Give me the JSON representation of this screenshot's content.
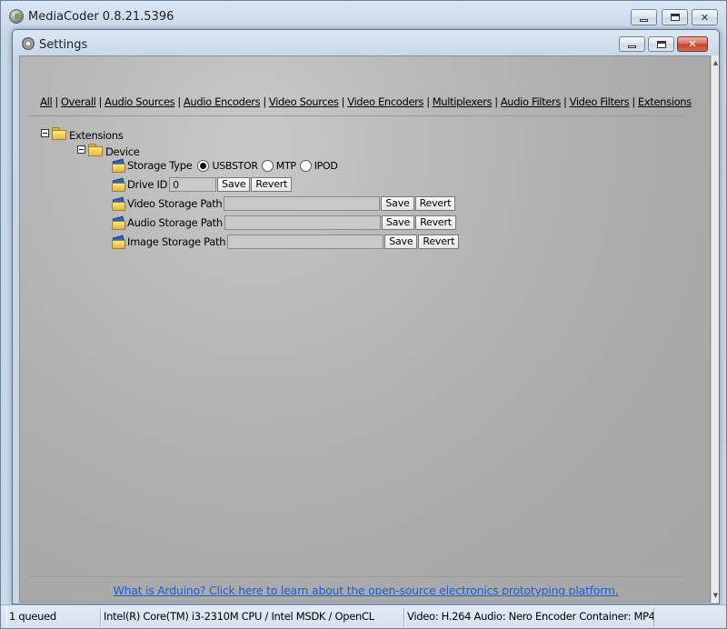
{
  "app": {
    "title": "MediaCoder 0.8.21.5396",
    "minimize_glyph": "",
    "close_glyph": "✕"
  },
  "settings": {
    "title": "Settings",
    "close_glyph": "✕"
  },
  "nav": {
    "items": [
      "All",
      "Overall",
      "Audio Sources",
      "Audio Encoders",
      "Video Sources",
      "Video Encoders",
      "Multiplexers",
      "Audio Filters",
      "Video Filters",
      "Extensions"
    ],
    "separator": "|"
  },
  "tree": {
    "root": "Extensions",
    "group": "Device",
    "storage_type": {
      "label": "Storage Type",
      "options": [
        "USBSTOR",
        "MTP",
        "IPOD"
      ],
      "selected": "USBSTOR"
    },
    "drive_id": {
      "label": "Drive ID",
      "value": "0"
    },
    "video_storage_path": {
      "label": "Video Storage Path",
      "value": ""
    },
    "audio_storage_path": {
      "label": "Audio Storage Path",
      "value": ""
    },
    "image_storage_path": {
      "label": "Image Storage Path",
      "value": ""
    },
    "save_label": "Save",
    "revert_label": "Revert"
  },
  "footer": {
    "link_text": "What is Arduino? Click here to learn about the open-source electronics prototyping platform."
  },
  "statusbar": {
    "queue": "1 queued",
    "cpu": "Intel(R) Core(TM) i3-2310M CPU  / Intel MSDK / OpenCL",
    "codec": "Video: H.264  Audio: Nero Encoder  Container: MP4"
  },
  "scrollbar": {
    "up_glyph": "▲",
    "down_glyph": "▼"
  }
}
